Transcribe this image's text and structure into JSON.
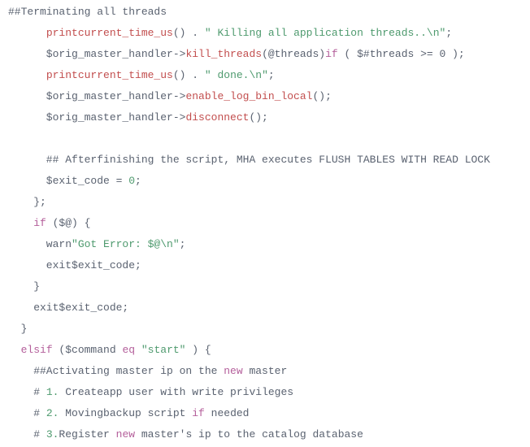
{
  "code": {
    "l01_a": "##Terminating all threads",
    "l02_a": "      ",
    "l02_b": "printcurrent_time_us",
    "l02_c": "() . ",
    "l02_d": "\" Killing all application threads..\\n\"",
    "l02_e": ";",
    "l03_a": "      $orig_master_handler->",
    "l03_b": "kill_threads",
    "l03_c": "(@threads)",
    "l03_d": "if",
    "l03_e": " ( $",
    "l03_f": "#threads >= 0 );",
    "l04_a": "      ",
    "l04_b": "printcurrent_time_us",
    "l04_c": "() . ",
    "l04_d": "\" done.\\n\"",
    "l04_e": ";",
    "l05_a": "      $orig_master_handler->",
    "l05_b": "enable_log_bin_local",
    "l05_c": "();",
    "l06_a": "      $orig_master_handler->",
    "l06_b": "disconnect",
    "l06_c": "();",
    "l07_a": "",
    "l08_a": "      ## Afterfinishing the script, MHA executes FLUSH TABLES WITH READ LOCK",
    "l09_a": "      $exit_code = ",
    "l09_b": "0",
    "l09_c": ";",
    "l10_a": "    };",
    "l11_a": "    ",
    "l11_b": "if",
    "l11_c": " ($@) {",
    "l12_a": "      warn",
    "l12_b": "\"Got Error: $@\\n\"",
    "l12_c": ";",
    "l13_a": "      exit$exit_code;",
    "l14_a": "    }",
    "l15_a": "    exit$exit_code;",
    "l16_a": "  }",
    "l17_a": "  ",
    "l17_b": "elsif",
    "l17_c": " ($command ",
    "l17_d": "eq",
    "l17_e": " ",
    "l17_f": "\"start\"",
    "l17_g": " ) {",
    "l18_a": "    ##Activating master ip on the ",
    "l18_b": "new",
    "l18_c": " master",
    "l19_a": "    # ",
    "l19_b": "1.",
    "l19_c": " Createapp user with write privileges",
    "l20_a": "    # ",
    "l20_b": "2.",
    "l20_c": " Movingbackup script ",
    "l20_d": "if",
    "l20_e": " needed",
    "l21_a": "    # ",
    "l21_b": "3.",
    "l21_c": "Register ",
    "l21_d": "new",
    "l21_e": " master's ip to the catalog database"
  }
}
